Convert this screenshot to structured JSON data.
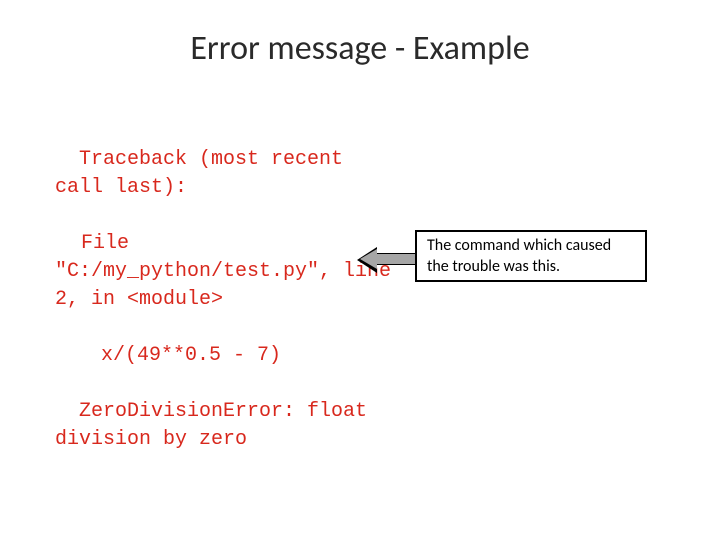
{
  "title": "Error message - Example",
  "traceback": {
    "line1": "Traceback (most recent call last):",
    "line2_pre": "File",
    "line2_rest": "\"C:/my_python/test.py\", line 2, in <module>",
    "line3": "x/(49**0.5 - 7)",
    "line4": "ZeroDivisionError: float division by zero"
  },
  "annotation": "The command which caused the trouble was this."
}
